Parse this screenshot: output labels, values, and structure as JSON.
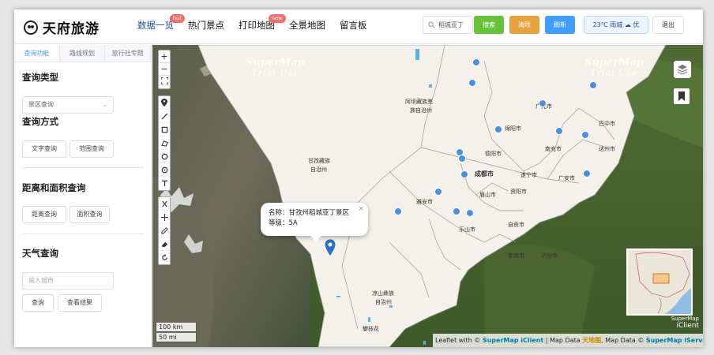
{
  "header": {
    "logo_text": "天府旅游",
    "nav": [
      {
        "label": "数据一览",
        "tag": "hot",
        "active": true
      },
      {
        "label": "热门景点",
        "tag": "",
        "active": false
      },
      {
        "label": "打印地图",
        "tag": "new",
        "active": false
      },
      {
        "label": "全景地图",
        "tag": "",
        "active": false
      },
      {
        "label": "留言板",
        "tag": "",
        "active": false
      }
    ],
    "search_value": "稻城亚丁",
    "search_btn": "搜索",
    "clear_btn": "清除",
    "refresh_btn": "刷新",
    "weather": "23℃ 雨城 ☁ 优",
    "logout": "退出"
  },
  "sidebar": {
    "tabs": [
      "查询功能",
      "路线规划",
      "旅行社专题"
    ],
    "query_type_title": "查询类型",
    "query_type_select": "景区查询",
    "query_method_title": "查询方式",
    "text_query_btn": "文字查询",
    "range_query_btn": "范围查询",
    "distance_title": "距离和面积查询",
    "distance_btn": "距离查询",
    "area_btn": "面积查询",
    "weather_title": "天气查询",
    "city_placeholder": "输入城市",
    "query_btn": "查询",
    "view_result_btn": "查看结果"
  },
  "map": {
    "watermark_line1": "SuperMap",
    "watermark_line2": "Trial Use",
    "popup_name": "名称：甘孜州稻城亚丁景区",
    "popup_level": "等级：5A",
    "scale_km": "100 km",
    "scale_mi": "50 mi",
    "iclient_top": "SuperMap",
    "iclient_bottom": "iClient",
    "attribution_prefix": "Leaflet with © ",
    "attribution_link1": "SuperMap iClient",
    "attribution_mid": " | Map Data ",
    "attribution_mid2": ", Map Data © ",
    "attribution_link2": "SuperMap iServer",
    "regions": [
      "阿坝藏族羌族自治州",
      "甘孜藏族自治州",
      "凉山彝族自治州",
      "广元市",
      "巴中市",
      "绵阳市",
      "南充市",
      "达州市",
      "德阳市",
      "成都市",
      "遂宁市",
      "广安市",
      "眉山市",
      "资阳市",
      "雅安市",
      "乐山市",
      "自贡市",
      "宜宾市",
      "泸州市",
      "攀枝花"
    ]
  }
}
